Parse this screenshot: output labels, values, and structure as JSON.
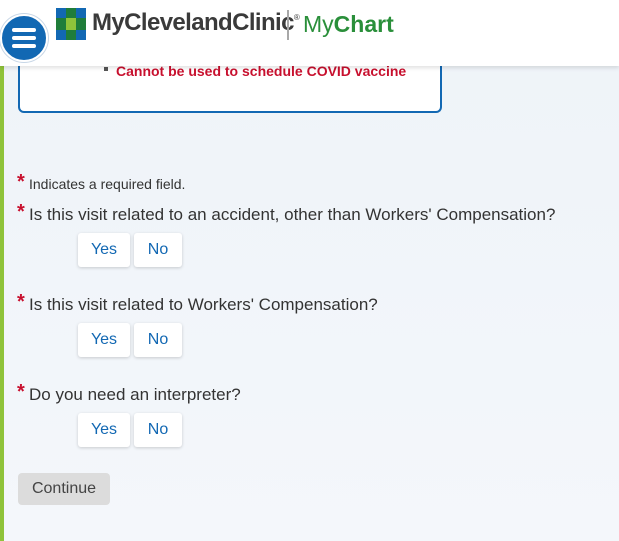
{
  "header": {
    "brand_name": "MyClevelandClinic",
    "brand_mark": "®",
    "product_prefix": "My",
    "product_suffix": "Chart"
  },
  "notice": {
    "bullet_text": "Cannot be used to schedule COVID vaccine"
  },
  "form": {
    "required_star": "*",
    "required_note": "Indicates a required field.",
    "questions": [
      {
        "text": "Is this visit related to an accident, other than Workers' Compensation?",
        "yes": "Yes",
        "no": "No"
      },
      {
        "text": "Is this visit related to Workers' Compensation?",
        "yes": "Yes",
        "no": "No"
      },
      {
        "text": "Do you need an interpreter?",
        "yes": "Yes",
        "no": "No"
      }
    ],
    "continue_label": "Continue"
  },
  "colors": {
    "primary_blue": "#1268b3",
    "required_red": "#c8102e",
    "brand_green": "#2a8f3a",
    "accent_green": "#8fc33a"
  },
  "icons": [
    "hamburger-menu-icon",
    "cleveland-clinic-logo-icon"
  ]
}
